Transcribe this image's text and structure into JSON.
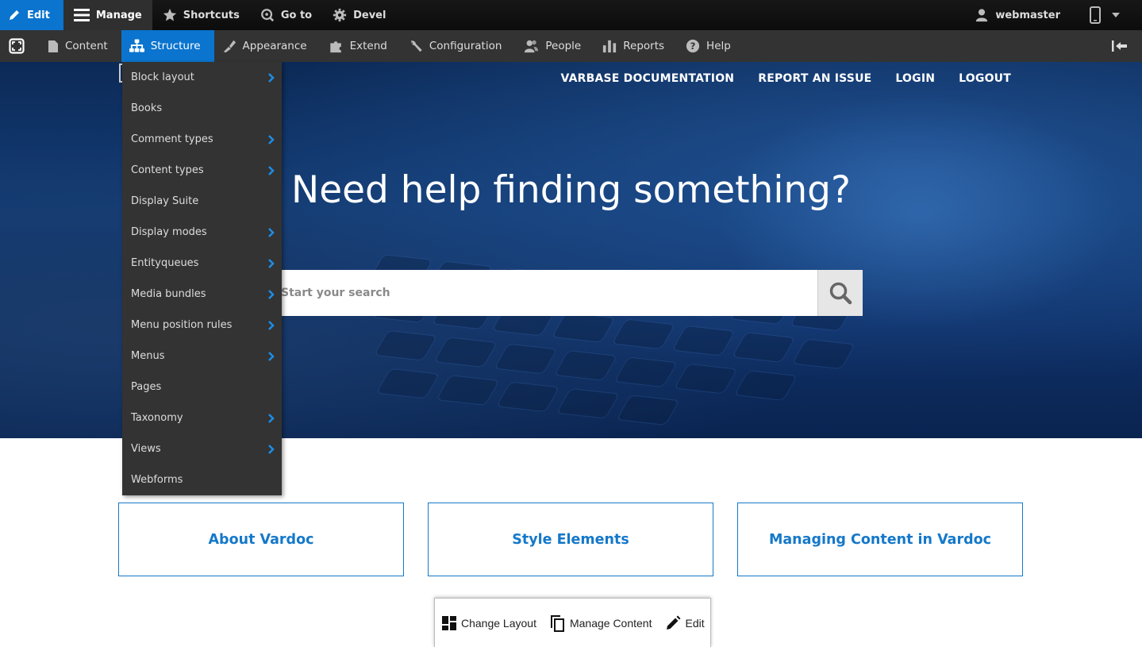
{
  "toolbar": {
    "edit_label": "Edit",
    "manage_label": "Manage",
    "shortcuts_label": "Shortcuts",
    "goto_label": "Go to",
    "devel_label": "Devel",
    "user_label": "webmaster"
  },
  "tray": {
    "items": [
      {
        "label": "Content",
        "icon": "page-icon"
      },
      {
        "label": "Structure",
        "icon": "sitemap-icon",
        "active": true
      },
      {
        "label": "Appearance",
        "icon": "paintbrush-icon"
      },
      {
        "label": "Extend",
        "icon": "puzzle-icon"
      },
      {
        "label": "Configuration",
        "icon": "wrench-icon"
      },
      {
        "label": "People",
        "icon": "people-icon"
      },
      {
        "label": "Reports",
        "icon": "bar-chart-icon"
      },
      {
        "label": "Help",
        "icon": "help-icon"
      }
    ]
  },
  "structure_menu": {
    "items": [
      {
        "label": "Block layout",
        "has_children": true
      },
      {
        "label": "Books",
        "has_children": false
      },
      {
        "label": "Comment types",
        "has_children": true
      },
      {
        "label": "Content types",
        "has_children": true
      },
      {
        "label": "Display Suite",
        "has_children": false
      },
      {
        "label": "Display modes",
        "has_children": true
      },
      {
        "label": "Entityqueues",
        "has_children": true
      },
      {
        "label": "Media bundles",
        "has_children": true
      },
      {
        "label": "Menu position rules",
        "has_children": true
      },
      {
        "label": "Menus",
        "has_children": true
      },
      {
        "label": "Pages",
        "has_children": false
      },
      {
        "label": "Taxonomy",
        "has_children": true
      },
      {
        "label": "Views",
        "has_children": true
      },
      {
        "label": "Webforms",
        "has_children": false
      }
    ]
  },
  "hero": {
    "nav": [
      "VARBASE DOCUMENTATION",
      "REPORT AN ISSUE",
      "LOGIN",
      "LOGOUT"
    ],
    "title": "Need help finding something?",
    "search_placeholder": "Start your search"
  },
  "cards": [
    "About Vardoc",
    "Style Elements",
    "Managing Content in Vardoc"
  ],
  "layout_builder": {
    "change_layout": "Change Layout",
    "manage_content": "Manage Content",
    "edit": "Edit"
  },
  "colors": {
    "accent": "#0a74cf",
    "admin_bar": "#0f0f0f",
    "tray": "#333333",
    "link": "#1578c9"
  }
}
